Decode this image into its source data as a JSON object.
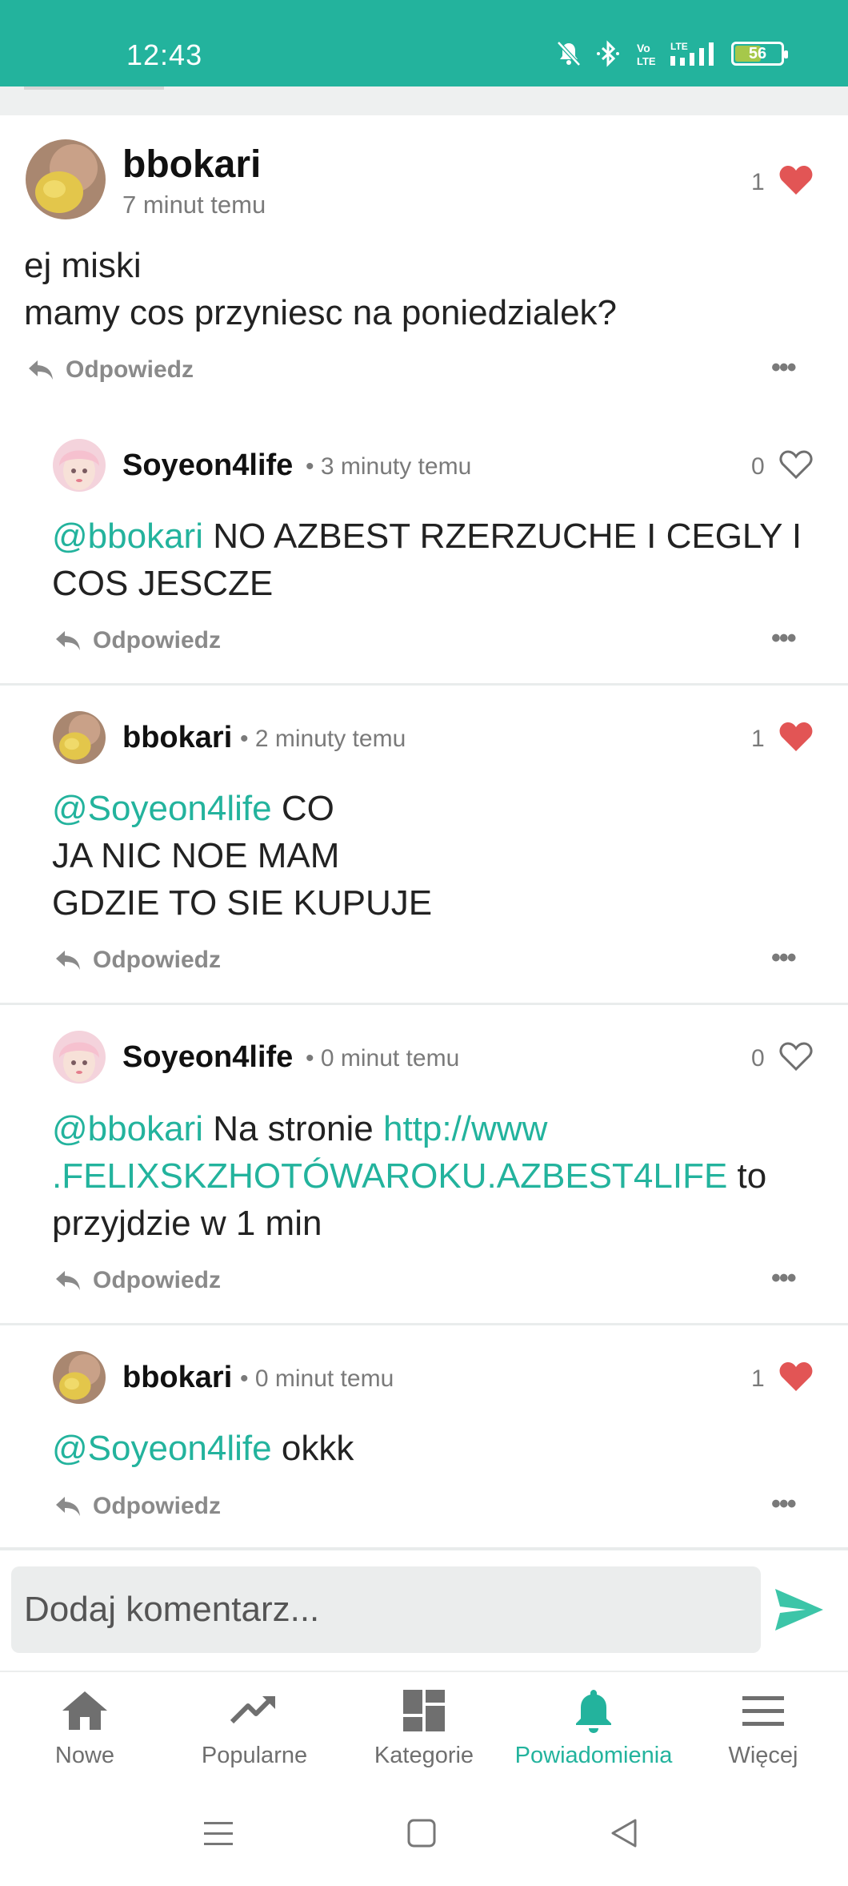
{
  "status_bar": {
    "time": "12:43",
    "battery": "56",
    "battery_level": 0.56,
    "icons": [
      "mute-icon",
      "bluetooth-icon",
      "volte-icon",
      "lte-signal-icon",
      "battery-icon"
    ]
  },
  "post": {
    "username": "bbokari",
    "time": "7 minut temu",
    "likes": "1",
    "liked": true,
    "text_line1": "ej miski",
    "text_line2": "mamy cos przyniesc na poniedzialek?",
    "reply_label": "Odpowiedz"
  },
  "replies": [
    {
      "username": "Soyeon4life",
      "time": "3 minuty temu",
      "likes": "0",
      "liked": false,
      "mention": "@bbokari",
      "text": " NO AZBEST RZERZUCHE I CEGLY I COS JESCZE",
      "reply_label": "Odpowiedz"
    },
    {
      "username": "bbokari",
      "time": "2 minuty temu",
      "likes": "1",
      "liked": true,
      "mention": "@Soyeon4life",
      "text_line1": " CO",
      "text_line2": "JA NIC NOE MAM",
      "text_line3": "GDZIE TO SIE KUPUJE",
      "reply_label": "Odpowiedz"
    },
    {
      "username": "Soyeon4life",
      "time": "0 minut temu",
      "likes": "0",
      "liked": false,
      "mention": "@bbokari",
      "text_before_link": " Na stronie ",
      "link_line1": "http://www",
      "link_line2": ".FELIXSKZHOTÓWAROKU.AZBEST4LIFE",
      "text_after_link": " to",
      "text_line3": "przyjdzie w 1 min",
      "reply_label": "Odpowiedz"
    },
    {
      "username": "bbokari",
      "time": "0 minut temu",
      "likes": "1",
      "liked": true,
      "mention": "@Soyeon4life",
      "text": " okkk",
      "reply_label": "Odpowiedz"
    }
  ],
  "comment_box": {
    "placeholder": "Dodaj komentarz..."
  },
  "bottom_nav": {
    "items": [
      {
        "label": "Nowe",
        "icon": "home-icon"
      },
      {
        "label": "Popularne",
        "icon": "trending-icon"
      },
      {
        "label": "Kategorie",
        "icon": "grid-icon"
      },
      {
        "label": "Powiadomienia",
        "icon": "bell-icon",
        "active": true
      },
      {
        "label": "Więcej",
        "icon": "menu-icon"
      }
    ]
  },
  "colors": {
    "accent": "#23b39d",
    "heart": "#e25555",
    "text": "#222222",
    "muted": "#7a7a7a"
  }
}
